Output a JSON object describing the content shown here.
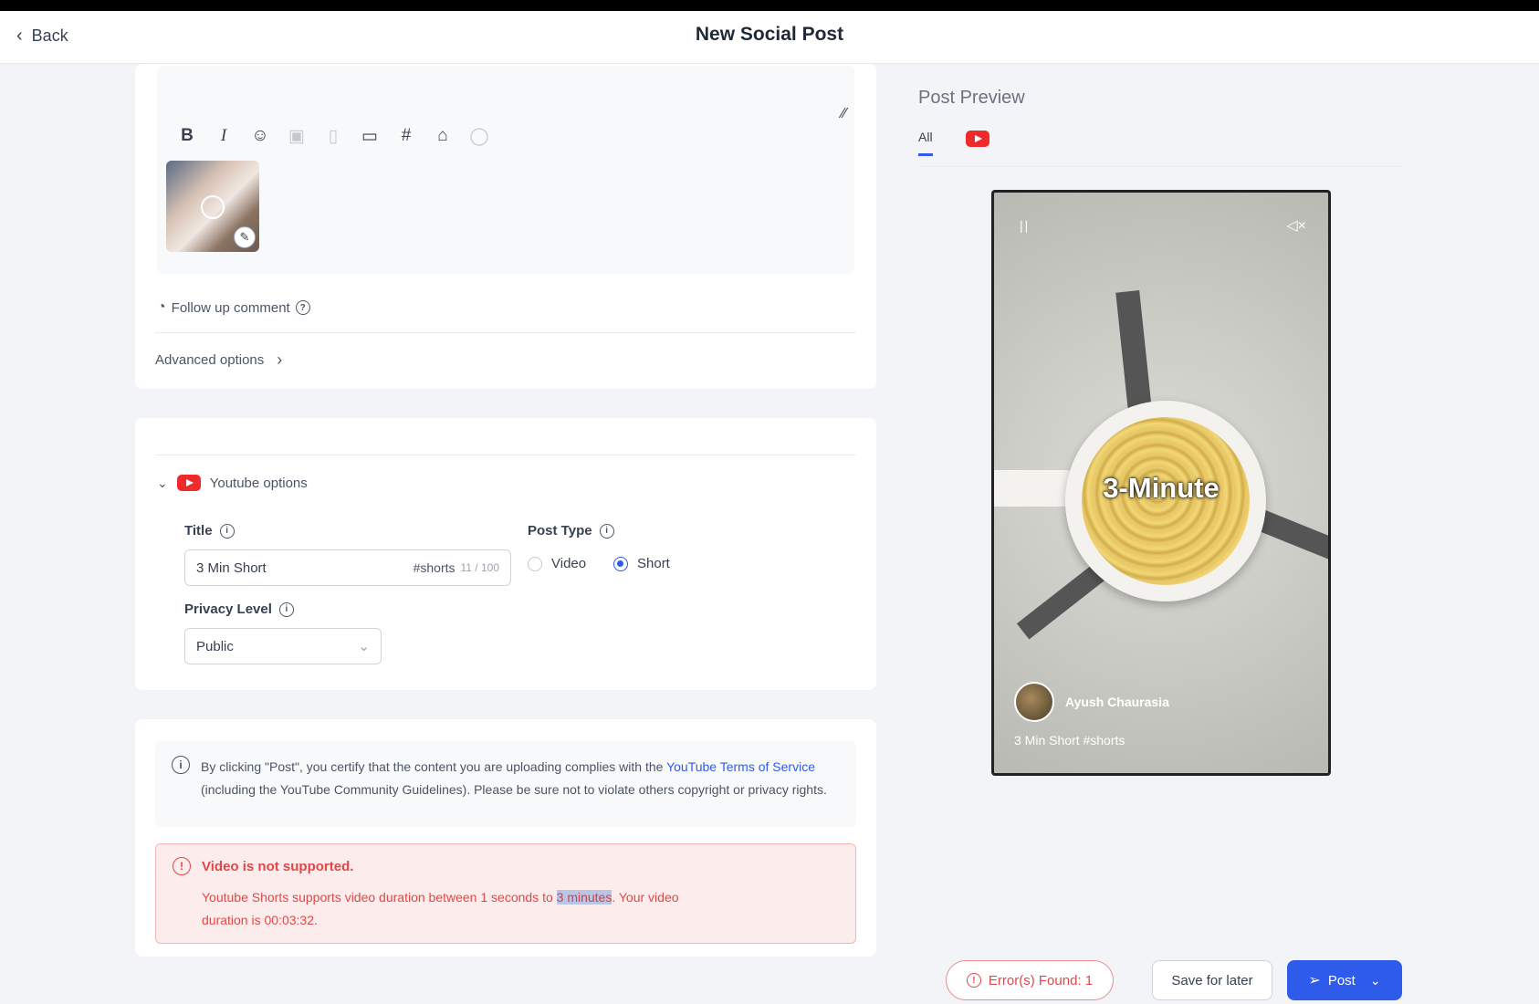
{
  "header": {
    "back_label": "Back",
    "title": "New Social Post"
  },
  "editor": {
    "follow_up": "Follow up comment",
    "advanced": "Advanced options"
  },
  "youtube": {
    "section_label": "Youtube options",
    "title_label": "Title",
    "title_value": "3 Min Short",
    "title_suffix": "#shorts",
    "title_count": "11 / 100",
    "post_type_label": "Post Type",
    "post_type_options": [
      "Video",
      "Short"
    ],
    "post_type_selected": "Short",
    "privacy_label": "Privacy Level",
    "privacy_value": "Public"
  },
  "notice": {
    "text_before": "By clicking \"Post\", you certify that the content you are uploading complies with the",
    "link": "YouTube Terms of Service",
    "text_after": "(including the YouTube Community Guidelines). Please be sure",
    "text_line3": "not to violate others copyright or privacy rights."
  },
  "error": {
    "title": "Video is not supported.",
    "text_before": "Youtube Shorts supports video duration between 1 seconds to",
    "highlight": "3 minutes",
    "text_after": ". Your video",
    "text_line2": "duration is 00:03:32."
  },
  "preview": {
    "title": "Post Preview",
    "tab_all": "All",
    "overlay_text": "3-Minute",
    "author": "Ayush Chaurasia",
    "caption": "3 Min Short #shorts"
  },
  "footer": {
    "errors_label": "Error(s) Found: 1",
    "save_label": "Save for later",
    "post_label": "Post"
  },
  "colors": {
    "accent": "#2f5bea",
    "error": "#e04848",
    "youtube": "#ef2a2a"
  }
}
